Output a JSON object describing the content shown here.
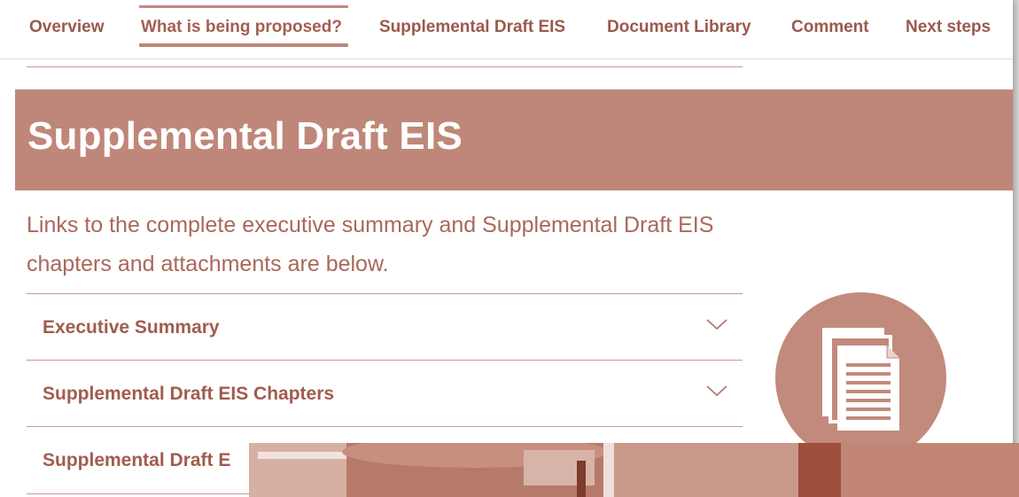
{
  "nav": {
    "tabs": [
      {
        "label": "Overview"
      },
      {
        "label": "What is being proposed?"
      },
      {
        "label": "Supplemental Draft EIS"
      },
      {
        "label": "Document Library"
      },
      {
        "label": "Comment"
      },
      {
        "label": "Next steps"
      }
    ],
    "active_tab": "What is being proposed?"
  },
  "banner": {
    "title": "Supplemental Draft EIS"
  },
  "intro_text": "Links to the complete executive summary and Supplemental Draft EIS chapters and attachments are below.",
  "accordion": [
    {
      "label": "Executive Summary"
    },
    {
      "label": "Supplemental Draft EIS Chapters"
    },
    {
      "label": "Supplemental Draft E"
    }
  ],
  "icons": {
    "documents": "documents-icon",
    "chevron": "chevron-down-icon"
  },
  "colors": {
    "accent": "#bf8779",
    "text": "#a9685a",
    "background": "#ffffff"
  }
}
